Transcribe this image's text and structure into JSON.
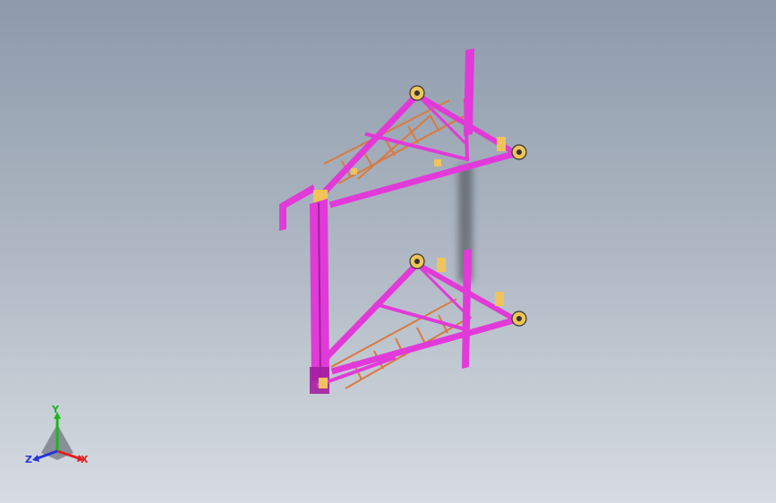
{
  "colors": {
    "frame": "#e23ad9",
    "frame_dark": "#a31f9e",
    "rung": "#d97a3f",
    "plate": "#f0c45a",
    "shadow": "#3d4047",
    "axis_x": "#e02020",
    "axis_y": "#17b817",
    "axis_z": "#2536d8",
    "triad_base": "#7d838c"
  },
  "triad": {
    "x_label": "X",
    "y_label": "Y",
    "z_label": "Z"
  }
}
